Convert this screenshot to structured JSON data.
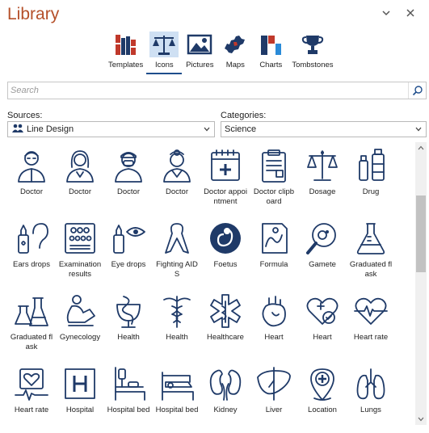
{
  "header": {
    "title": "Library"
  },
  "tabs": [
    {
      "label": "Templates",
      "icon": "books-icon"
    },
    {
      "label": "Icons",
      "icon": "scales-icon",
      "active": true
    },
    {
      "label": "Pictures",
      "icon": "picture-icon"
    },
    {
      "label": "Maps",
      "icon": "map-icon"
    },
    {
      "label": "Charts",
      "icon": "chart-icon"
    },
    {
      "label": "Tombstones",
      "icon": "trophy-icon"
    }
  ],
  "search": {
    "placeholder": "Search"
  },
  "sources": {
    "label": "Sources:",
    "value": "Line Design"
  },
  "categories": {
    "label": "Categories:",
    "value": "Science"
  },
  "colors": {
    "title": "#b5502a",
    "icon_stroke": "#1f3a68",
    "accent": "#1f4e8c"
  },
  "icons": [
    {
      "label": "Doctor",
      "icon": "doctor-male-icon"
    },
    {
      "label": "Doctor",
      "icon": "doctor-female-icon"
    },
    {
      "label": "Doctor",
      "icon": "doctor-mask-icon"
    },
    {
      "label": "Doctor",
      "icon": "doctor-mirror-icon"
    },
    {
      "label": "Doctor appointment",
      "icon": "calendar-cross-icon"
    },
    {
      "label": "Doctor clipboard",
      "icon": "clipboard-icon"
    },
    {
      "label": "Dosage",
      "icon": "balance-icon"
    },
    {
      "label": "Drug",
      "icon": "vial-icon"
    },
    {
      "label": "Ears drops",
      "icon": "ear-drops-icon"
    },
    {
      "label": "Examination results",
      "icon": "eye-chart-icon"
    },
    {
      "label": "Eye drops",
      "icon": "eye-drops-icon"
    },
    {
      "label": "Fighting AIDS",
      "icon": "ribbon-icon"
    },
    {
      "label": "Foetus",
      "icon": "foetus-icon"
    },
    {
      "label": "Formula",
      "icon": "formula-icon"
    },
    {
      "label": "Gamete",
      "icon": "magnifier-icon"
    },
    {
      "label": "Graduated flask",
      "icon": "flask-icon"
    },
    {
      "label": "Graduated flask",
      "icon": "flasks-icon"
    },
    {
      "label": "Gynecology",
      "icon": "gynecology-icon"
    },
    {
      "label": "Health",
      "icon": "hygieia-icon"
    },
    {
      "label": "Health",
      "icon": "caduceus-icon"
    },
    {
      "label": "Healthcare",
      "icon": "star-of-life-icon"
    },
    {
      "label": "Heart",
      "icon": "anatomical-heart-icon"
    },
    {
      "label": "Heart",
      "icon": "heart-shield-icon"
    },
    {
      "label": "Heart rate",
      "icon": "heart-pulse-icon"
    },
    {
      "label": "Heart rate",
      "icon": "heart-monitor-icon"
    },
    {
      "label": "Hospital",
      "icon": "hospital-sign-icon"
    },
    {
      "label": "Hospital bed",
      "icon": "hospital-bed-drip-icon"
    },
    {
      "label": "Hospital bed",
      "icon": "hospital-bed-icon"
    },
    {
      "label": "Kidney",
      "icon": "kidney-icon"
    },
    {
      "label": "Liver",
      "icon": "liver-icon"
    },
    {
      "label": "Location",
      "icon": "location-pin-icon"
    },
    {
      "label": "Lungs",
      "icon": "lungs-icon"
    }
  ]
}
